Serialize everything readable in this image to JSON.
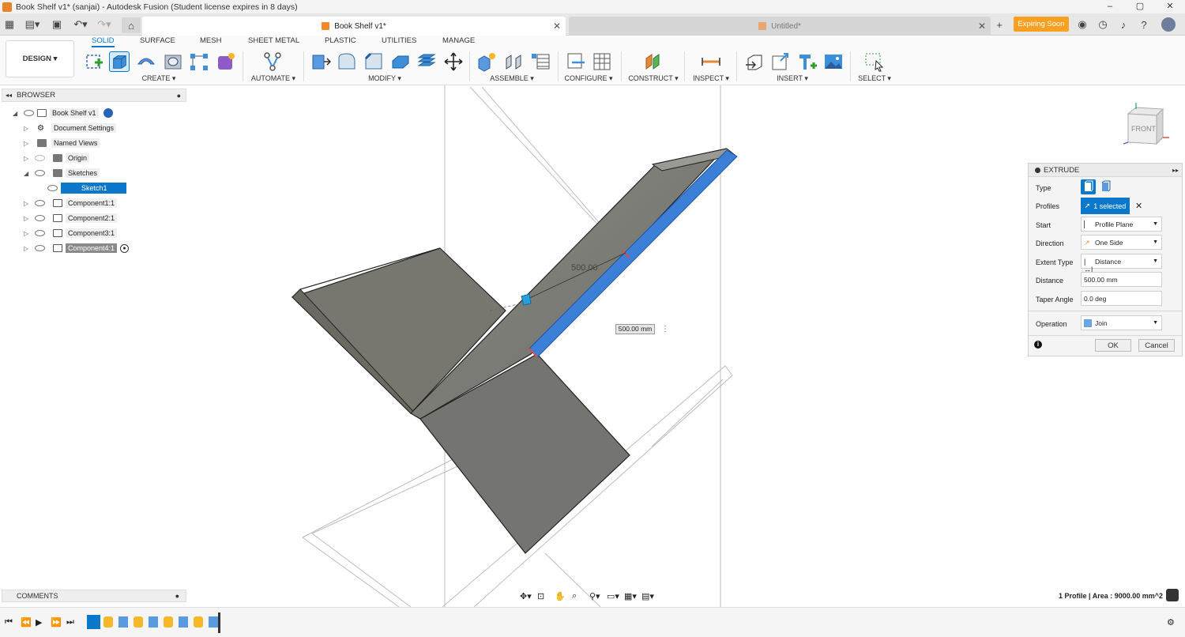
{
  "window": {
    "title": "Book Shelf v1* (sanjai) - Autodesk Fusion (Student license expires in 8 days)"
  },
  "tabs": {
    "active": "Book Shelf v1*",
    "inactive": "Untitled*",
    "expiring": "Expiring Soon"
  },
  "toolbar": {
    "design": "DESIGN ▾",
    "workspaces": [
      "SOLID",
      "SURFACE",
      "MESH",
      "SHEET METAL",
      "PLASTIC",
      "UTILITIES",
      "MANAGE"
    ],
    "groups": [
      "CREATE ▾",
      "AUTOMATE ▾",
      "MODIFY ▾",
      "ASSEMBLE ▾",
      "CONFIGURE ▾",
      "CONSTRUCT ▾",
      "INSPECT ▾",
      "INSERT ▾",
      "SELECT ▾"
    ]
  },
  "browser": {
    "title": "BROWSER",
    "items": [
      {
        "label": "Book Shelf v1"
      },
      {
        "label": "Document Settings"
      },
      {
        "label": "Named Views"
      },
      {
        "label": "Origin"
      },
      {
        "label": "Sketches"
      },
      {
        "label": "Sketch1"
      },
      {
        "label": "Component1:1"
      },
      {
        "label": "Component2:1"
      },
      {
        "label": "Component3:1"
      },
      {
        "label": "Component4:1"
      }
    ]
  },
  "viewport": {
    "dimension_label": "500.00",
    "dimension_input": "500.00 mm",
    "viewcube_face": "FRONT"
  },
  "extrude": {
    "title": "EXTRUDE",
    "type_label": "Type",
    "profiles_label": "Profiles",
    "profiles_value": "1 selected",
    "start_label": "Start",
    "start_value": "Profile Plane",
    "direction_label": "Direction",
    "direction_value": "One Side",
    "extent_label": "Extent Type",
    "extent_value": "Distance",
    "distance_label": "Distance",
    "distance_value": "500.00 mm",
    "taper_label": "Taper Angle",
    "taper_value": "0.0 deg",
    "operation_label": "Operation",
    "operation_value": "Join",
    "ok": "OK",
    "cancel": "Cancel"
  },
  "comments": {
    "label": "COMMENTS"
  },
  "status": {
    "text": "1 Profile | Area : 9000.00 mm^2"
  }
}
